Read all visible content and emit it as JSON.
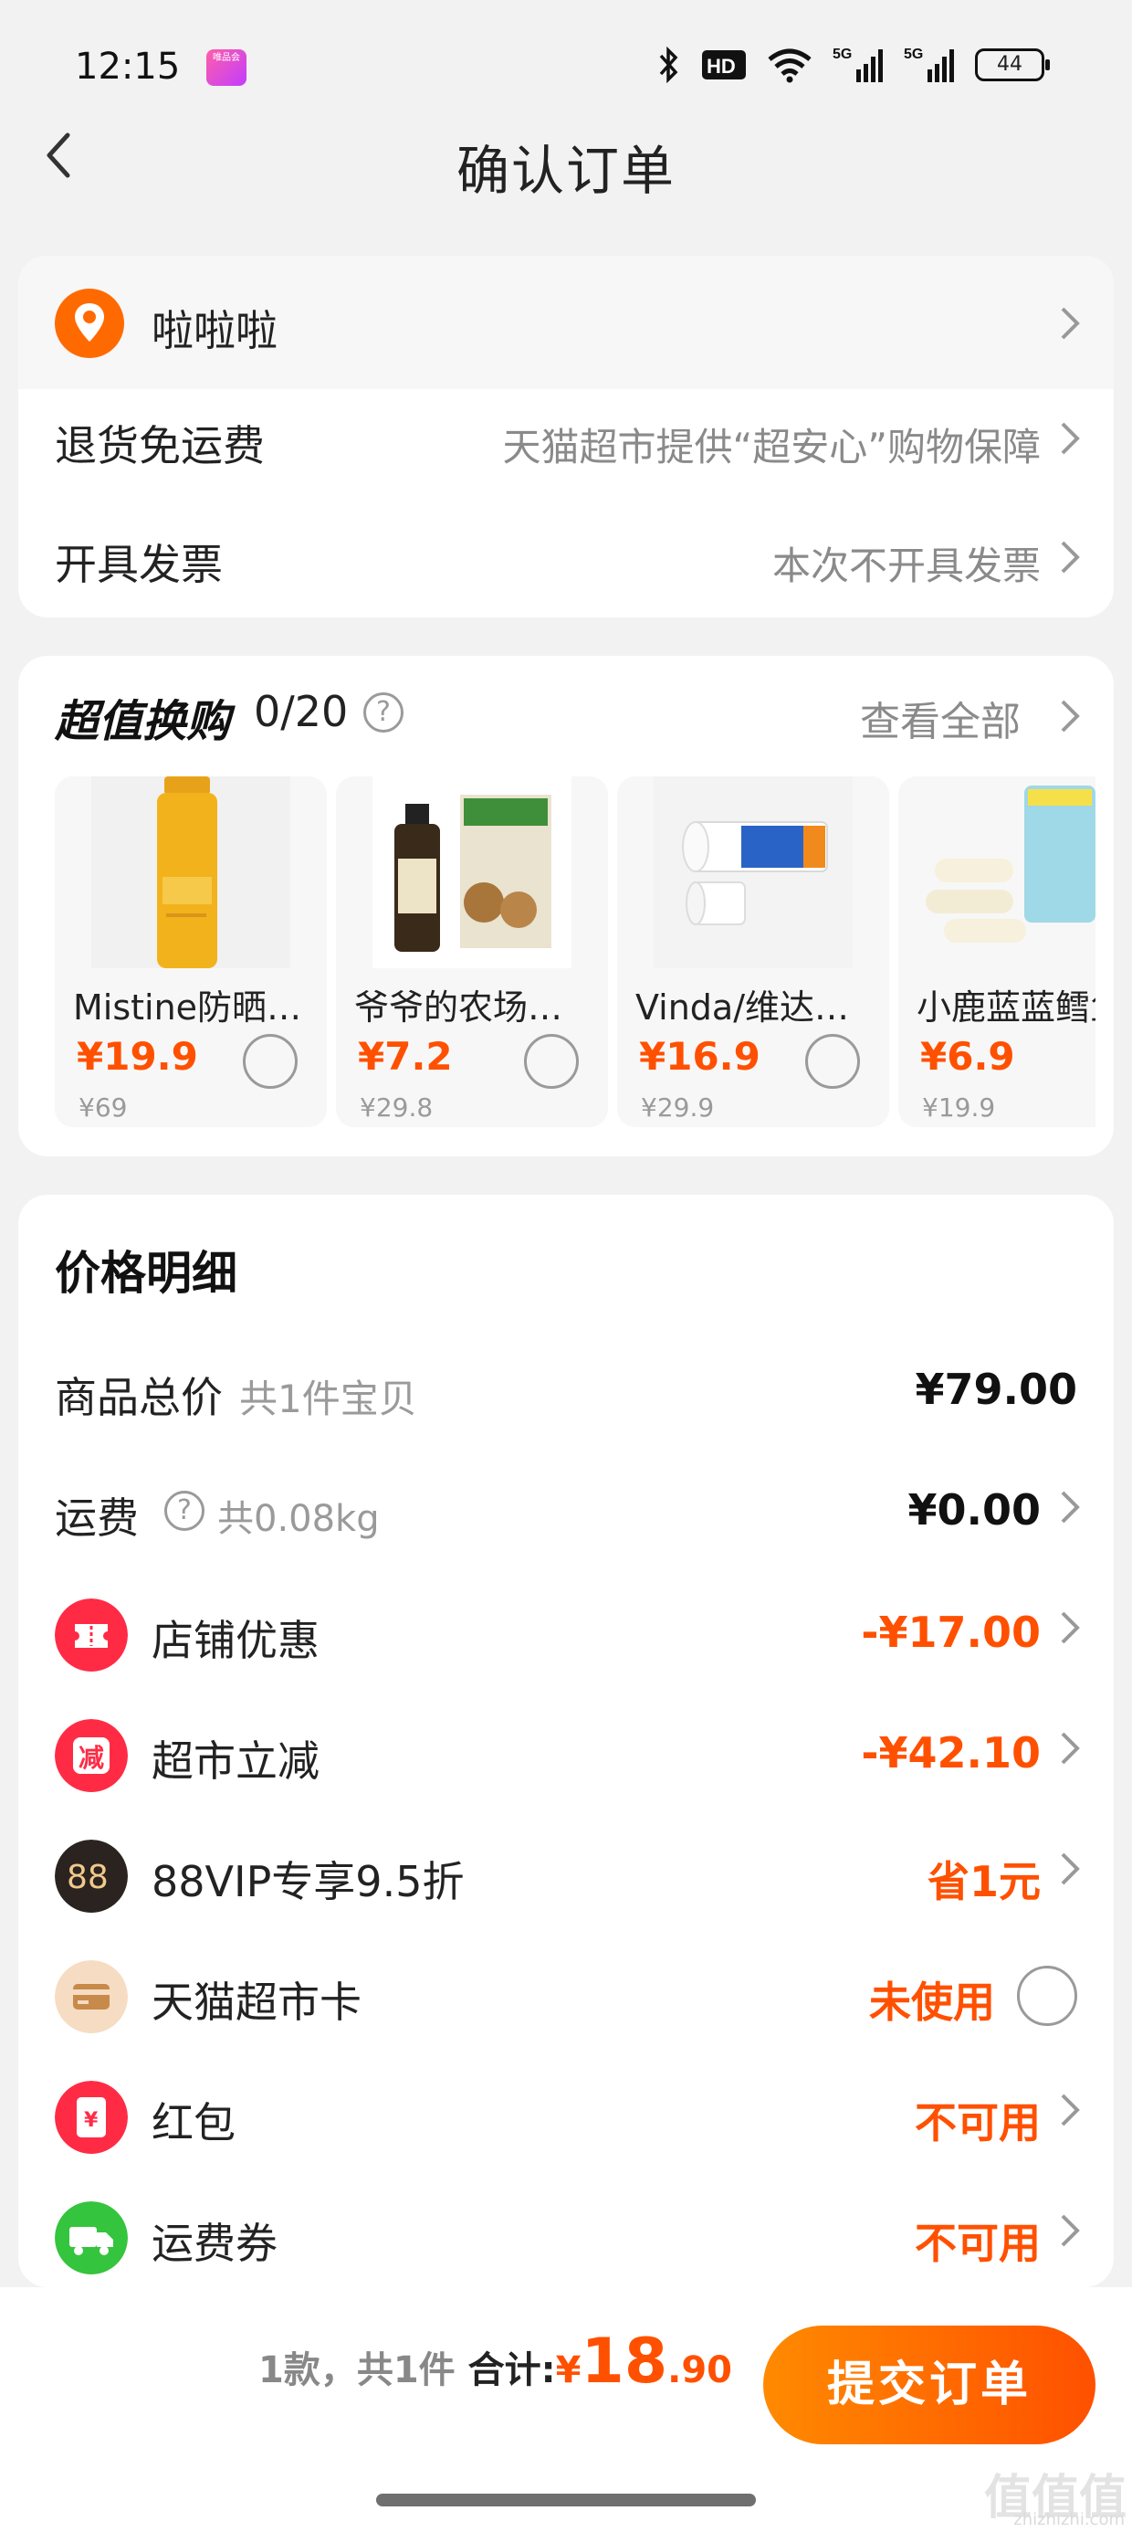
{
  "status_bar": {
    "time": "12:15",
    "app_badge": "唯品会",
    "icons": [
      "bluetooth-icon",
      "hd-icon",
      "wifi-icon",
      "signal-5g-icon",
      "signal-5g-icon"
    ],
    "hd_label": "HD",
    "sig1": "5G",
    "sig2": "5G",
    "battery": "44"
  },
  "nav": {
    "title": "确认订单"
  },
  "address": {
    "text": "啦啦啦"
  },
  "service_rows": [
    {
      "label": "退货免运费",
      "value": "天猫超市提供“超安心”购物保障"
    },
    {
      "label": "开具发票",
      "value": "本次不开具发票"
    }
  ],
  "swap": {
    "title": "超值换购",
    "count": "0/20",
    "help": "?",
    "view_all": "查看全部",
    "products": [
      {
        "name": "Mistine防晒喷雾",
        "price": "¥19.9",
        "original": "¥69"
      },
      {
        "name": "爷爷的农场核桃油",
        "price": "¥7.2",
        "original": "¥29.8"
      },
      {
        "name": "Vinda/维达卷纸",
        "price": "¥16.9",
        "original": "¥29.9"
      },
      {
        "name": "小鹿蓝蓝鳕鱼肠",
        "price": "¥6.9",
        "original": "¥19.9"
      }
    ]
  },
  "price_detail": {
    "title": "价格明细",
    "goods_total": {
      "label": "商品总价",
      "sub": "共1件宝贝",
      "value": "¥79.00"
    },
    "shipping": {
      "label": "运费",
      "sub": "共0.08kg",
      "value": "¥0.00"
    },
    "discounts": [
      {
        "label": "店铺优惠",
        "value": "-¥17.00",
        "icon": "coupon-icon"
      },
      {
        "label": "超市立减",
        "value": "-¥42.10",
        "icon": "minus-badge-icon",
        "glyph": "减"
      },
      {
        "label": "88VIP专享9.5折",
        "value": "省1元",
        "icon": "vip88-icon",
        "glyph": "88"
      },
      {
        "label": "天猫超市卡",
        "value": "未使用",
        "icon": "card-icon"
      },
      {
        "label": "红包",
        "value": "不可用",
        "icon": "red-packet-icon",
        "glyph": "¥"
      },
      {
        "label": "运费券",
        "value": "不可用",
        "icon": "truck-icon"
      }
    ]
  },
  "footer": {
    "count_text": "1款，共1件",
    "total_label": "合计:",
    "currency": "¥",
    "amount_int": "18",
    "amount_dec": ".90",
    "submit": "提交订单"
  },
  "watermark": {
    "text": "值值值",
    "url": "zhizhizhi.com"
  },
  "colors": {
    "accent": "#ff5000",
    "brand_gradient_start": "#ff8a00"
  }
}
